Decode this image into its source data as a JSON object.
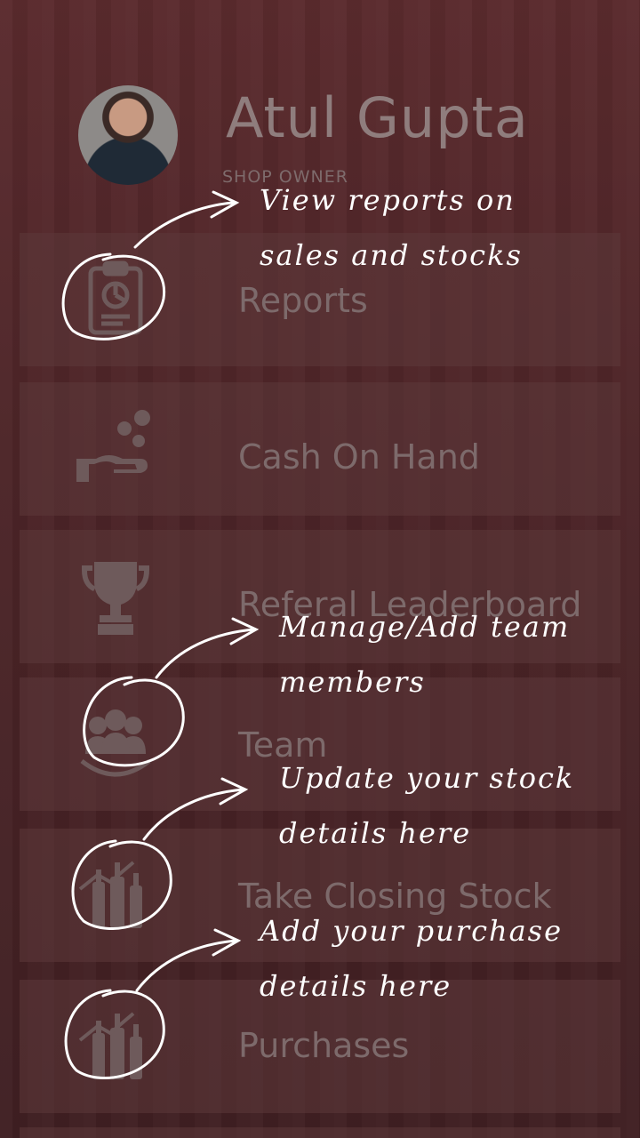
{
  "profile": {
    "name": "Atul Gupta",
    "role": "SHOP OWNER"
  },
  "menu": {
    "items": [
      {
        "label": "Reports",
        "icon": "reports-clipboard-icon"
      },
      {
        "label": "Cash On Hand",
        "icon": "cash-hand-icon"
      },
      {
        "label": "Referal Leaderboard",
        "icon": "trophy-icon"
      },
      {
        "label": "Team",
        "icon": "team-icon"
      },
      {
        "label": "Take Closing Stock",
        "icon": "bottles-stock-icon"
      },
      {
        "label": "Purchases",
        "icon": "bottles-purchase-icon"
      }
    ]
  },
  "annotations": [
    {
      "line1": "View reports on",
      "line2": "sales and stocks"
    },
    {
      "line1": "Manage/Add team",
      "line2": "members"
    },
    {
      "line1": "Update your stock",
      "line2": "details here"
    },
    {
      "line1": "Add your purchase",
      "line2": "details here"
    }
  ],
  "colors": {
    "background": "#4a2426",
    "menu_item": "#5c383a",
    "muted_text": "#7d6a6b",
    "annotation": "#ffffff"
  }
}
